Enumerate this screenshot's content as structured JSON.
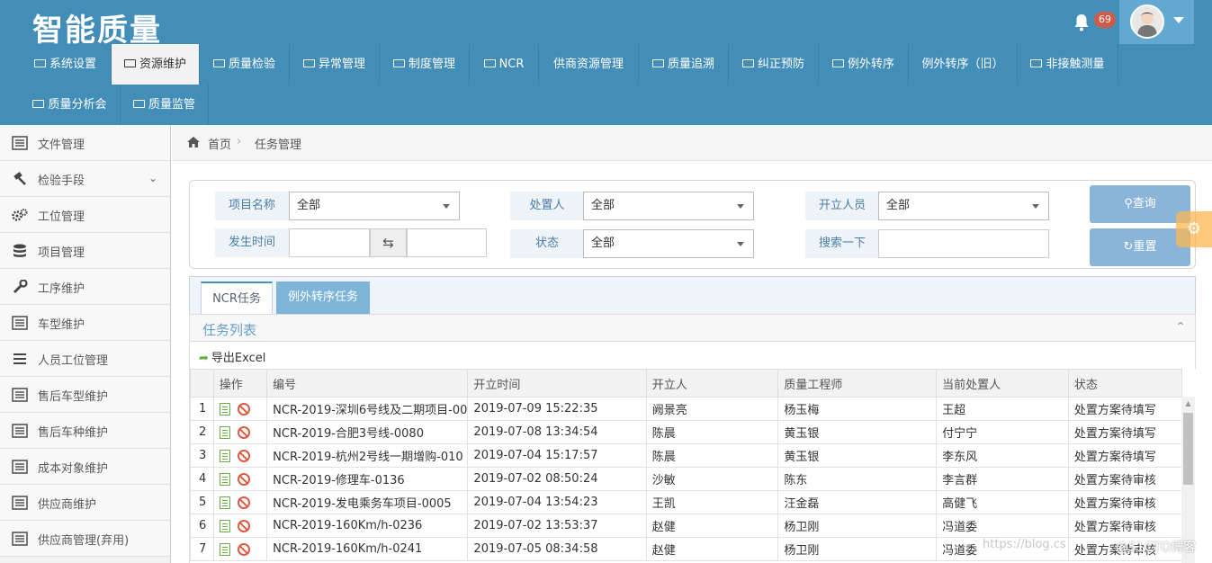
{
  "header": {
    "logo": "智能质量",
    "notification_count": "69",
    "nav": [
      {
        "label": "系统设置"
      },
      {
        "label": "资源维护"
      },
      {
        "label": "质量检验"
      },
      {
        "label": "异常管理"
      },
      {
        "label": "制度管理"
      },
      {
        "label": "NCR"
      },
      {
        "label": "供商资源管理"
      },
      {
        "label": "质量追溯"
      },
      {
        "label": "纠正预防"
      },
      {
        "label": "例外转序"
      },
      {
        "label": "例外转序（旧）"
      },
      {
        "label": "非接触测量"
      },
      {
        "label": "质量分析会"
      },
      {
        "label": "质量监管"
      }
    ]
  },
  "sidebar": {
    "items": [
      {
        "label": "文件管理"
      },
      {
        "label": "检验手段"
      },
      {
        "label": "工位管理"
      },
      {
        "label": "项目管理"
      },
      {
        "label": "工序维护"
      },
      {
        "label": "车型维护"
      },
      {
        "label": "人员工位管理"
      },
      {
        "label": "售后车型维护"
      },
      {
        "label": "售后车种维护"
      },
      {
        "label": "成本对象维护"
      },
      {
        "label": "供应商维护"
      },
      {
        "label": "供应商管理(弃用)"
      }
    ]
  },
  "breadcrumb": {
    "home": "首页",
    "current": "任务管理"
  },
  "filters": {
    "project_label": "项目名称",
    "project_value": "全部",
    "handler_label": "处置人",
    "handler_value": "全部",
    "creator_label": "开立人员",
    "creator_value": "全部",
    "time_label": "发生时间",
    "status_label": "状态",
    "status_value": "全部",
    "search_label": "搜索一下",
    "query_button": "查询",
    "reset_button": "重置"
  },
  "tabs": [
    {
      "label": "NCR任务"
    },
    {
      "label": "例外转序任务"
    }
  ],
  "widget": {
    "title": "任务列表",
    "export": "导出Excel"
  },
  "table": {
    "columns": [
      "操作",
      "编号",
      "开立时间",
      "开立人",
      "质量工程师",
      "当前处置人",
      "状态"
    ],
    "rows": [
      {
        "n": "1",
        "code": "NCR-2019-深圳6号线及二期项目-00",
        "time": "2019-07-09 15:22:35",
        "creator": "阙景亮",
        "engineer": "杨玉梅",
        "handler": "王超",
        "status": "处置方案待填写"
      },
      {
        "n": "2",
        "code": "NCR-2019-合肥3号线-0080",
        "time": "2019-07-08 13:34:54",
        "creator": "陈晨",
        "engineer": "黄玉银",
        "handler": "付宁宁",
        "status": "处置方案待填写"
      },
      {
        "n": "3",
        "code": "NCR-2019-杭州2号线一期增购-010",
        "time": "2019-07-04 15:17:57",
        "creator": "陈晨",
        "engineer": "黄玉银",
        "handler": "李东风",
        "status": "处置方案待填写"
      },
      {
        "n": "4",
        "code": "NCR-2019-修理车-0136",
        "time": "2019-07-02 08:50:24",
        "creator": "沙敏",
        "engineer": "陈东",
        "handler": "李言群",
        "status": "处置方案待审核"
      },
      {
        "n": "5",
        "code": "NCR-2019-发电乘务车项目-0005",
        "time": "2019-07-04 13:54:23",
        "creator": "王凯",
        "engineer": "汪金磊",
        "handler": "高健飞",
        "status": "处置方案待审核"
      },
      {
        "n": "6",
        "code": "NCR-2019-160Km/h-0236",
        "time": "2019-07-02 13:53:37",
        "creator": "赵健",
        "engineer": "杨卫刚",
        "handler": "冯道委",
        "status": "处置方案待审核"
      },
      {
        "n": "7",
        "code": "NCR-2019-160Km/h-0241",
        "time": "2019-07-05 08:34:58",
        "creator": "赵健",
        "engineer": "杨卫刚",
        "handler": "冯道委",
        "status": "处置方案待审核"
      }
    ]
  },
  "watermark": "https://blog.cs",
  "watermark2": "@51CTO博客",
  "colors": {
    "header": "#438eb9",
    "button": "#8ab4d8",
    "badge": "#d15b47"
  }
}
